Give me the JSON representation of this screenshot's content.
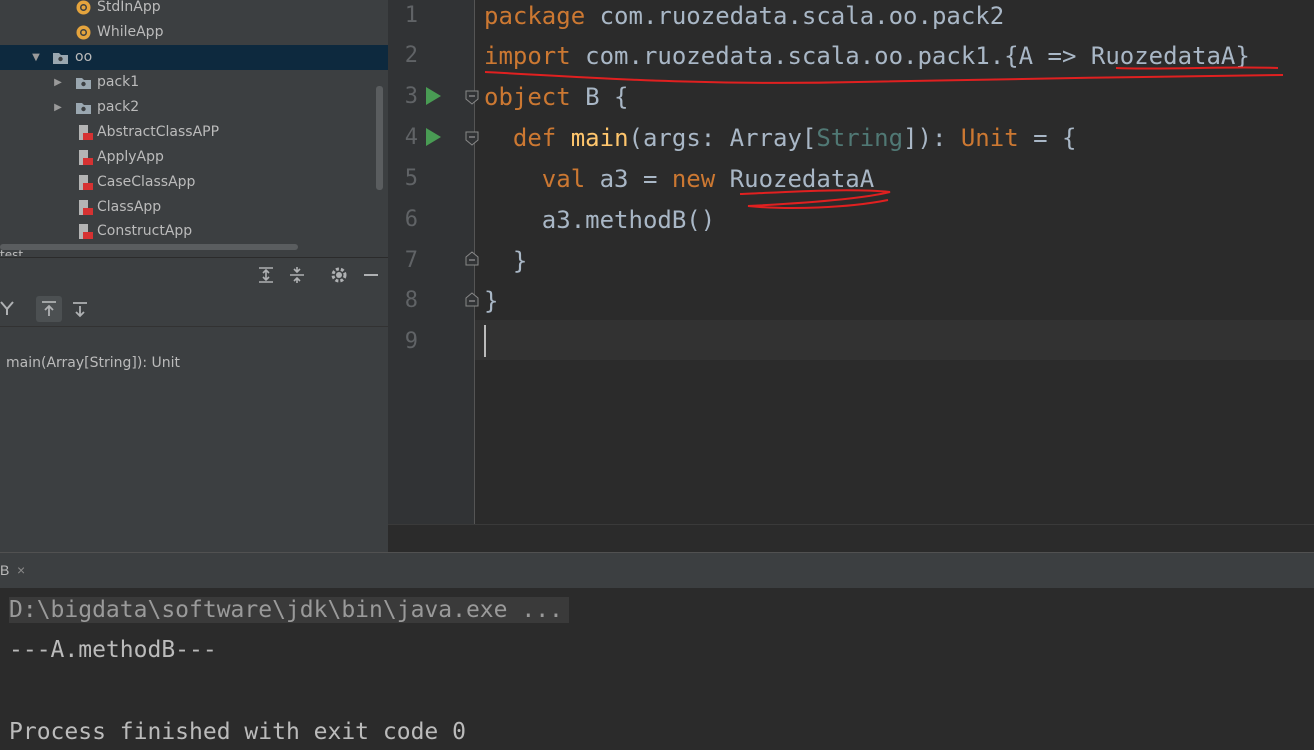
{
  "project_tree": {
    "items": [
      {
        "label": "StdInApp",
        "icon": "scala-object-icon"
      },
      {
        "label": "WhileApp",
        "icon": "scala-object-icon"
      },
      {
        "label": "oo",
        "icon": "package-folder-icon",
        "expand": "▼"
      },
      {
        "label": "pack1",
        "icon": "package-folder-icon",
        "expand": "▶"
      },
      {
        "label": "pack2",
        "icon": "package-folder-icon",
        "expand": "▶"
      },
      {
        "label": "AbstractClassAPP",
        "icon": "scala-class-icon"
      },
      {
        "label": "ApplyApp",
        "icon": "scala-class-icon"
      },
      {
        "label": "CaseClassApp",
        "icon": "scala-class-icon"
      },
      {
        "label": "ClassApp",
        "icon": "scala-class-icon"
      },
      {
        "label": "ConstructApp",
        "icon": "scala-class-icon"
      }
    ],
    "cut_off_label": "test"
  },
  "structure": {
    "toolbar_icons": [
      "expand-all-icon",
      "collapse-all-icon",
      "gear-icon",
      "minimize-icon"
    ],
    "filter_icons": [
      "filter-icon",
      "sort-up-icon",
      "sort-down-icon"
    ],
    "item": "main(Array[String]): Unit"
  },
  "editor": {
    "line_numbers": [
      "1",
      "2",
      "3",
      "4",
      "5",
      "6",
      "7",
      "8",
      "9"
    ],
    "lines": [
      {
        "kw": "package",
        "rest": " com.ruozedata.scala.oo.pack2"
      },
      {
        "kw": "import",
        "rest": " com.ruozedata.scala.oo.pack1.{A => RuozedataA}"
      },
      {
        "kw": "object",
        "rest": " B {"
      },
      {
        "indent": "  ",
        "kw": "def",
        "sp": " ",
        "fn": "main",
        "a": "(args: Array[",
        "ty": "String",
        "b": "]): ",
        "kw2": "Unit",
        "c": " = {"
      },
      {
        "indent": "    ",
        "kw": "val",
        "a": " a3 = ",
        "kw2": "new",
        "b": " RuozedataA"
      },
      {
        "text": "    a3.methodB()"
      },
      {
        "text": "  }"
      },
      {
        "text": "}"
      }
    ]
  },
  "run_panel": {
    "tab_label": "B",
    "close": "×",
    "console": {
      "command": "D:\\bigdata\\software\\jdk\\bin\\java.exe ...",
      "output": "---A.methodB---",
      "exit": "Process finished with exit code 0"
    }
  },
  "colors": {
    "annotation": "#e02020",
    "keyword": "#cc7832",
    "function": "#ffc66d",
    "type": "#507874"
  }
}
